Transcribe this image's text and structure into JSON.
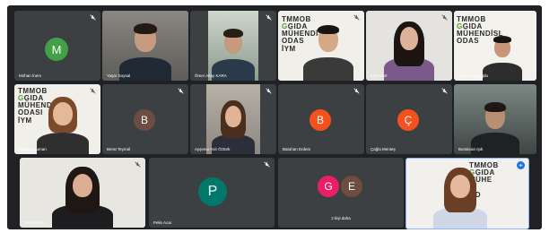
{
  "participants": [
    {
      "name": "Mirhan İnem",
      "initial": "M",
      "avatar_color": "#43a047",
      "type": "avatar"
    },
    {
      "name": "Yaşar Soysal",
      "type": "video"
    },
    {
      "name": "Ömer Altay KARA",
      "type": "video"
    },
    {
      "name": "",
      "type": "video",
      "logo": [
        "TMMOB",
        "GIDA",
        "MÜHENDİSL",
        "ODAS",
        "İYM"
      ]
    },
    {
      "name": "İrem Kurt",
      "type": "video"
    },
    {
      "name": "Ozan Gündoğdu",
      "type": "video",
      "logo": [
        "TMMOB",
        "GIDA",
        "MÜHENDİSL",
        "ODAS"
      ]
    },
    {
      "name": "Zeynep Duman",
      "type": "video",
      "logo": [
        "TMMOB",
        "GIDA",
        "MÜHENDİSLİ",
        "ODASI",
        "İYM"
      ]
    },
    {
      "name": "Berat Teymül",
      "initial": "B",
      "avatar_color": "#6d4c41",
      "type": "avatar"
    },
    {
      "name": "Ayşenur Aslı Öztürk",
      "type": "video"
    },
    {
      "name": "Batuhan Erdem",
      "initial": "B",
      "avatar_color": "#f4511e",
      "type": "avatar"
    },
    {
      "name": "Çağla Menteş",
      "initial": "Ç",
      "avatar_color": "#f4511e",
      "type": "avatar"
    },
    {
      "name": "Burakcan Işık",
      "type": "video"
    },
    {
      "name": "Melis Aydın",
      "type": "video"
    },
    {
      "name": "Pelin Acar",
      "initial": "P",
      "avatar_color": "#00796b",
      "type": "avatar"
    },
    {
      "name": "2 kişi daha",
      "initials": [
        "G",
        "E"
      ],
      "avatar_colors": [
        "#e91e63",
        "#6d4c41"
      ],
      "type": "group"
    },
    {
      "name": "",
      "type": "video",
      "logo": [
        "TMMOB",
        "GIDA",
        "MÜHE",
        "Rİ",
        "OD",
        "İY"
      ]
    }
  ]
}
